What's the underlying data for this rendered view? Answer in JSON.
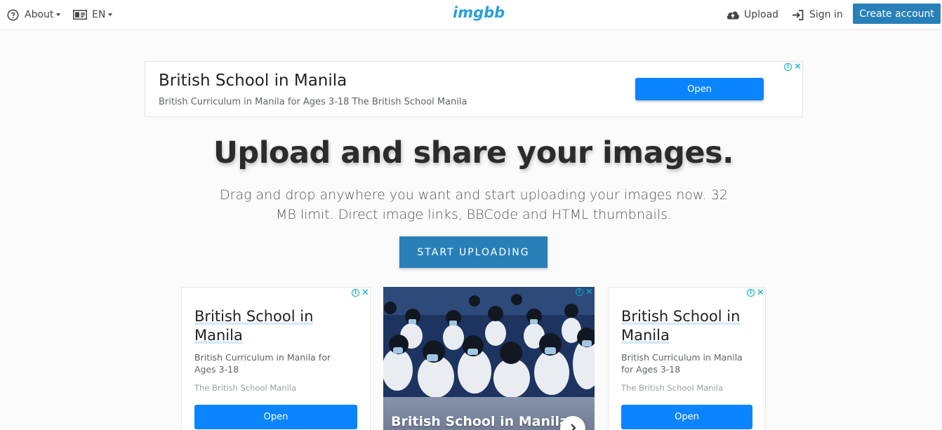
{
  "topbar": {
    "about_label": "About",
    "language_label": "EN",
    "logo": "imgbb",
    "upload_label": "Upload",
    "signin_label": "Sign in",
    "create_account_label": "Create account"
  },
  "ad_top": {
    "title": "British School in Manila",
    "description": "British Curriculum in Manila for Ages 3-18 The British School Manila",
    "open_label": "Open"
  },
  "hero": {
    "title": "Upload and share your images.",
    "subtitle": "Drag and drop anywhere you want and start uploading your images now. 32 MB limit. Direct image links, BBCode and HTML thumbnails.",
    "cta_label": "START UPLOADING"
  },
  "ads_bottom": {
    "left": {
      "title_line1": "British School in",
      "title_line2": "Manila",
      "description": "British Curriculum in Manila for Ages 3-18",
      "source": "The British School Manila",
      "open_label": "Open"
    },
    "middle": {
      "title": "British School in Manila"
    },
    "right": {
      "title_line1": "British School in",
      "title_line2": "Manila",
      "description": "British Curriculum in Manila for Ages 3-18",
      "source": "The British School Manila",
      "open_label": "Open"
    }
  },
  "colors": {
    "primary": "#2980b9",
    "logo": "#2a9fd6",
    "ad_button": "#0a84ff",
    "adchoices": "#00aecd"
  }
}
